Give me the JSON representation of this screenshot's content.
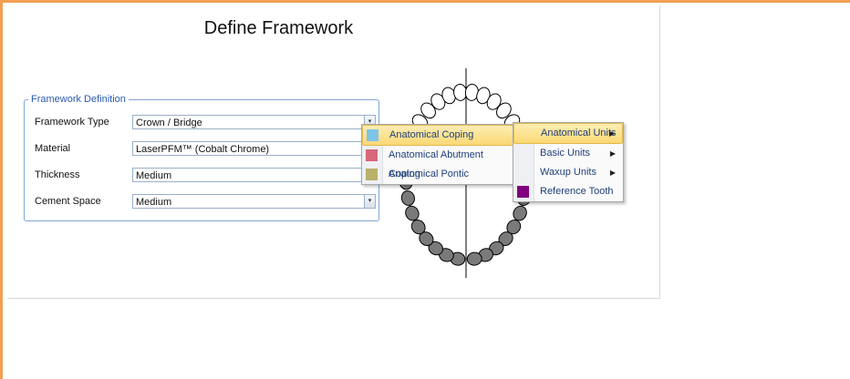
{
  "page": {
    "title": "Define Framework"
  },
  "framework_definition": {
    "legend": "Framework Definition",
    "rows": [
      {
        "label": "Framework Type",
        "value": "Crown / Bridge"
      },
      {
        "label": "Material",
        "value": "LaserPFM™ (Cobalt Chrome)"
      },
      {
        "label": "Thickness",
        "value": "Medium"
      },
      {
        "label": "Cement Space",
        "value": "Medium"
      }
    ],
    "dropdown_glyph": "▾"
  },
  "submenu": {
    "items": [
      {
        "label": "Anatomical Coping",
        "swatch": "#7fc4e6",
        "highlighted": true
      },
      {
        "label": "Anatomical Abutment Coping",
        "swatch": "#d9667a",
        "highlighted": false
      },
      {
        "label": "Anatomical Pontic",
        "swatch": "#b9b06a",
        "highlighted": false
      }
    ]
  },
  "context_menu": {
    "items": [
      {
        "label": "Anatomical Units",
        "has_submenu": true,
        "highlighted": true
      },
      {
        "label": "Basic Units",
        "has_submenu": true,
        "highlighted": false
      },
      {
        "label": "Waxup Units",
        "has_submenu": true,
        "highlighted": false
      },
      {
        "label": "Reference Tooth",
        "swatch": "#800080",
        "has_submenu": false,
        "highlighted": false
      }
    ],
    "arrow_glyph": "▶"
  },
  "colors": {
    "accent_frame": "#f0a050",
    "group_border": "#7fa4d6",
    "menu_highlight": "#fbd874"
  }
}
